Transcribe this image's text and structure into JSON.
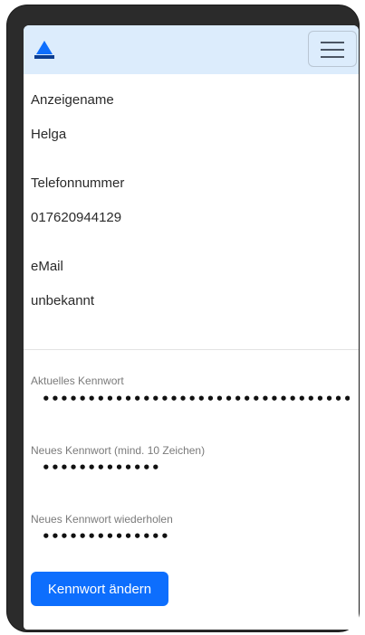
{
  "navbar": {
    "logo": "sailboat-logo-icon",
    "menu": "hamburger-icon"
  },
  "profile": {
    "display_name_label": "Anzeigename",
    "display_name_value": "Helga",
    "phone_label": "Telefonnummer",
    "phone_value": "017620944129",
    "email_label": "eMail",
    "email_value": "unbekannt"
  },
  "password_form": {
    "current_label": "Aktuelles Kennwort",
    "current_value": "••••••••••••••••••••••••••••••••••••••••••••",
    "new_label": "Neues Kennwort (mind. 10 Zeichen)",
    "new_value": "•••••••••••••",
    "repeat_label": "Neues Kennwort wiederholen",
    "repeat_value": "••••••••••••••",
    "submit_label": "Kennwort ändern"
  },
  "colors": {
    "navbar_bg": "#dcecfc",
    "primary": "#0d6efd"
  }
}
